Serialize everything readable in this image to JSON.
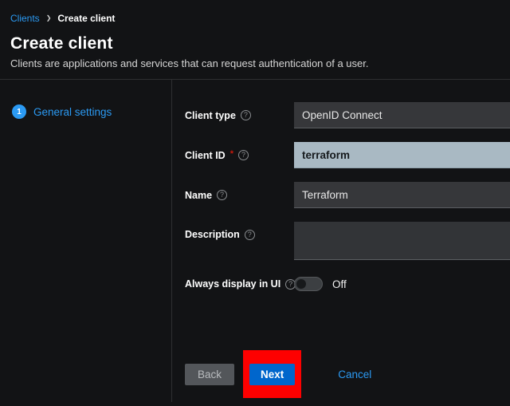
{
  "breadcrumb": {
    "clients": "Clients",
    "current": "Create client"
  },
  "header": {
    "title": "Create client",
    "subtitle": "Clients are applications and services that can request authentication of a user."
  },
  "wizard": {
    "step_number": "1",
    "step_label": "General settings"
  },
  "form": {
    "client_type": {
      "label": "Client type",
      "value": "OpenID Connect"
    },
    "client_id": {
      "label": "Client ID",
      "required_marker": "*",
      "value": "terraform"
    },
    "name": {
      "label": "Name",
      "value": "Terraform"
    },
    "description": {
      "label": "Description",
      "value": ""
    },
    "always_display": {
      "label": "Always display in UI",
      "state": "Off"
    }
  },
  "icons": {
    "breadcrumb_chevron": "❯",
    "help": "?"
  },
  "footer": {
    "back": "Back",
    "next": "Next",
    "cancel": "Cancel"
  },
  "colors": {
    "link": "#2b9af3",
    "primary": "#0066cc",
    "annotation": "#fe0000",
    "required": "#c9190b"
  }
}
